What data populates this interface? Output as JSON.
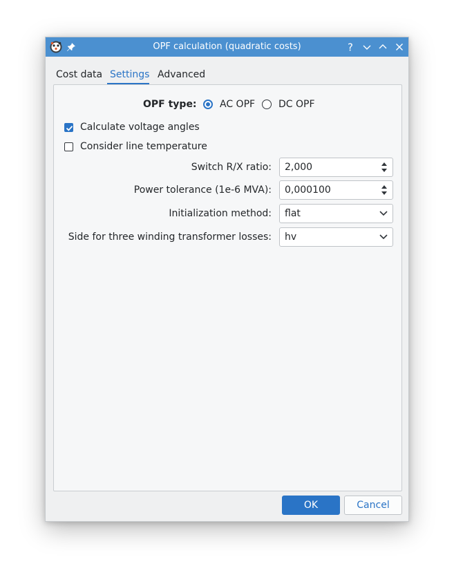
{
  "window": {
    "title": "OPF calculation (quadratic costs)",
    "app_icon": "pandapower-icon",
    "pin_icon": "pin-icon",
    "controls": [
      "help-icon",
      "minimize-icon",
      "maximize-icon",
      "close-icon"
    ],
    "help_glyph": "?"
  },
  "tabs": {
    "items": [
      "Cost data",
      "Settings",
      "Advanced"
    ],
    "active": "Settings"
  },
  "opf_type": {
    "label": "OPF type:",
    "options": [
      "AC OPF",
      "DC OPF"
    ],
    "selected": "AC OPF"
  },
  "checkboxes": [
    {
      "label": "Calculate voltage angles",
      "checked": true
    },
    {
      "label": "Consider line temperature",
      "checked": false
    }
  ],
  "fields": {
    "switch_rx": {
      "label": "Switch R/X ratio:",
      "value": "2,000"
    },
    "power_tolerance": {
      "label": "Power tolerance (1e-6 MVA):",
      "value": "0,000100"
    },
    "init_method": {
      "label": "Initialization method:",
      "value": "flat"
    },
    "trafo3w_losses": {
      "label": "Side for three winding transformer losses:",
      "value": "hv"
    }
  },
  "buttons": {
    "ok": "OK",
    "cancel": "Cancel"
  },
  "colors": {
    "titlebar": "#4b90d0",
    "accent": "#2a74c6",
    "window_bg": "#eff0f1",
    "text": "#232629"
  }
}
